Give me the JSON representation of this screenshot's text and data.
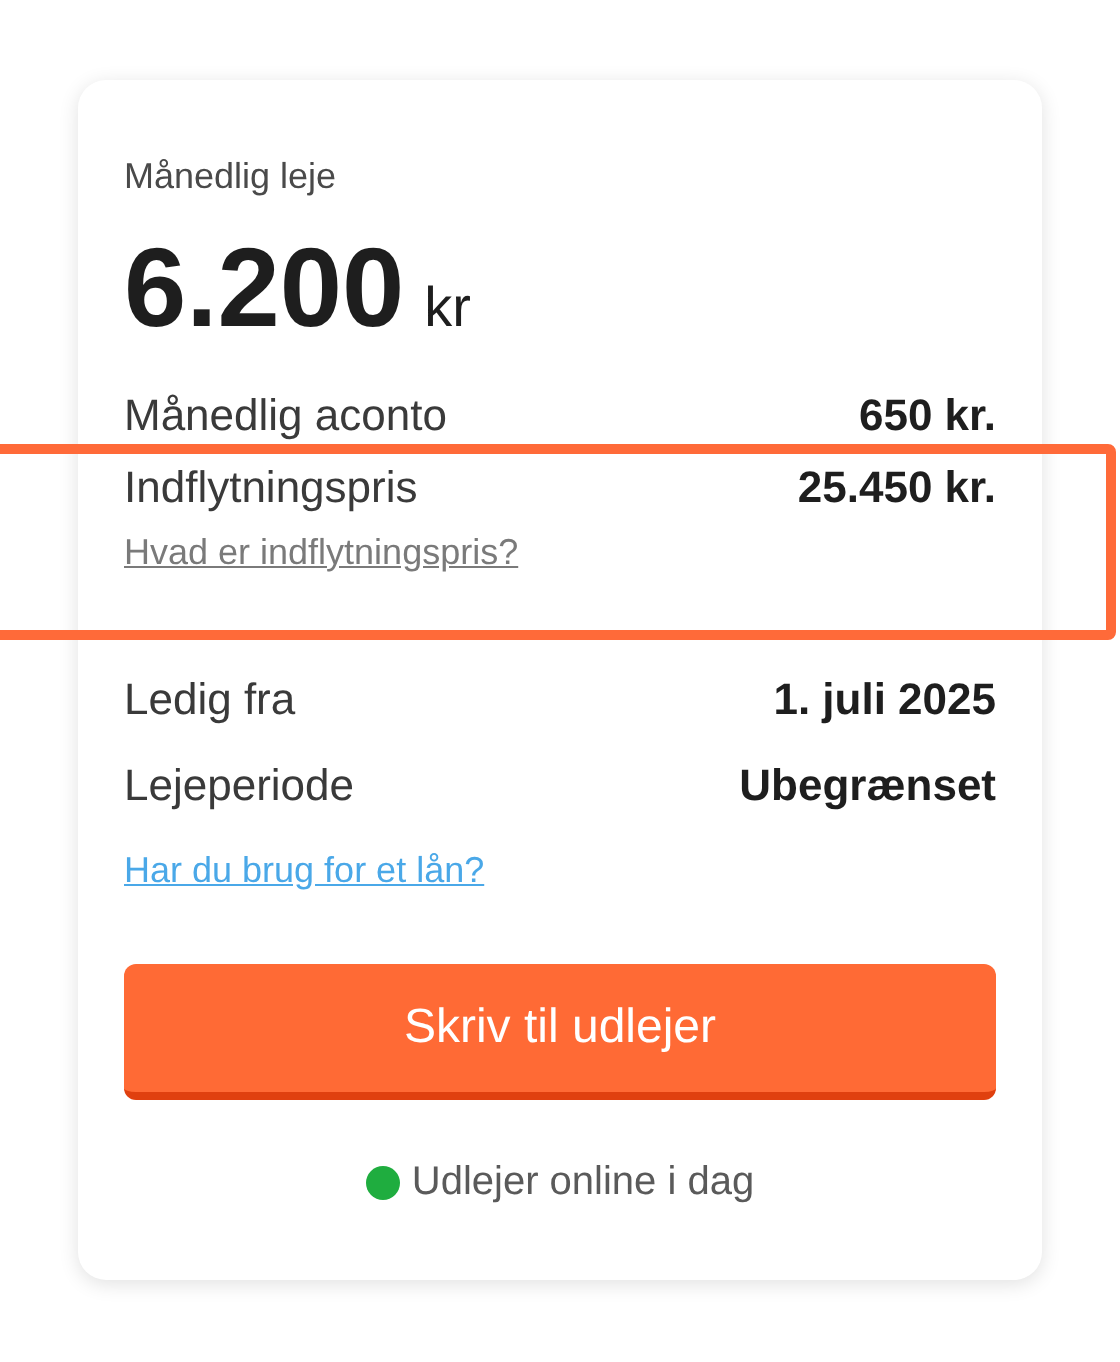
{
  "price": {
    "label": "Månedlig leje",
    "amount": "6.200",
    "unit": "kr"
  },
  "cost_rows": [
    {
      "label": "Månedlig aconto",
      "value": "650 kr.",
      "highlighted": false
    },
    {
      "label": "Indflytningspris",
      "value": "25.450 kr.",
      "highlighted": true,
      "link": "Hvad er indflytningspris?"
    }
  ],
  "info_rows": [
    {
      "label": "Ledig fra",
      "value": "1. juli 2025"
    },
    {
      "label": "Lejeperiode",
      "value": "Ubegrænset"
    }
  ],
  "loan_link": "Har du brug for et lån?",
  "contact_button": "Skriv til udlejer",
  "status": {
    "text": "Udlejer online i dag",
    "online": true
  }
}
